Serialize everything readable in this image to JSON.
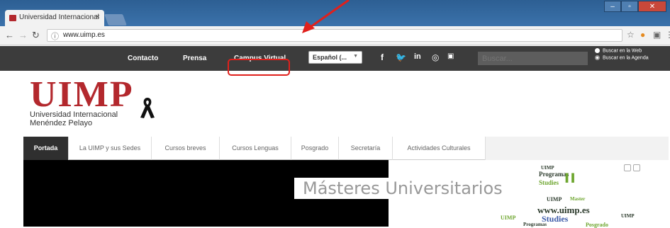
{
  "browser": {
    "tab_title": "Universidad Internacional",
    "tab_close": "×",
    "url": "www.uimp.es",
    "window": {
      "minimize": "–",
      "maximize": "▫",
      "close": "✕"
    }
  },
  "site": {
    "toplinks": [
      "Contacto",
      "Prensa",
      "Campus Virtual"
    ],
    "language": "Español (...",
    "search_placeholder": "Buscar...",
    "search_options": [
      "Buscar en la Web",
      "Buscar en la Agenda"
    ],
    "logo": {
      "word": "UIMP",
      "line1": "Universidad Internacional",
      "line2": "Menéndez Pelayo"
    },
    "nav": [
      "Portada",
      "La UIMP y sus Sedes",
      "Cursos breves",
      "Cursos Lenguas",
      "Posgrado",
      "Secretaría",
      "Actividades Culturales"
    ],
    "banner_title": "Másteres Universitarios"
  },
  "colors": {
    "brand_red": "#b3282d",
    "highlight": "#e0201c",
    "topbar": "#3c3c3c"
  }
}
